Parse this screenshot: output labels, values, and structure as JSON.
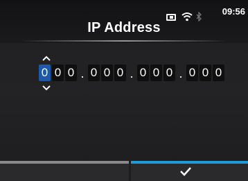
{
  "header": {
    "title": "IP Address",
    "time": "09:56",
    "icons": [
      "sd-card-icon",
      "wifi-icon",
      "bluetooth-icon"
    ]
  },
  "ip_input": {
    "digits": [
      "0",
      "0",
      "0",
      "0",
      "0",
      "0",
      "0",
      "0",
      "0",
      "0",
      "0",
      "0"
    ],
    "separator": ".",
    "active_digit_index": 0,
    "active_color": "#1f5aa8"
  },
  "footer": {
    "left_button": {
      "label": "",
      "accent": "#8a8a8a"
    },
    "right_button": {
      "icon": "checkmark-icon",
      "accent": "#1f9adb"
    }
  }
}
